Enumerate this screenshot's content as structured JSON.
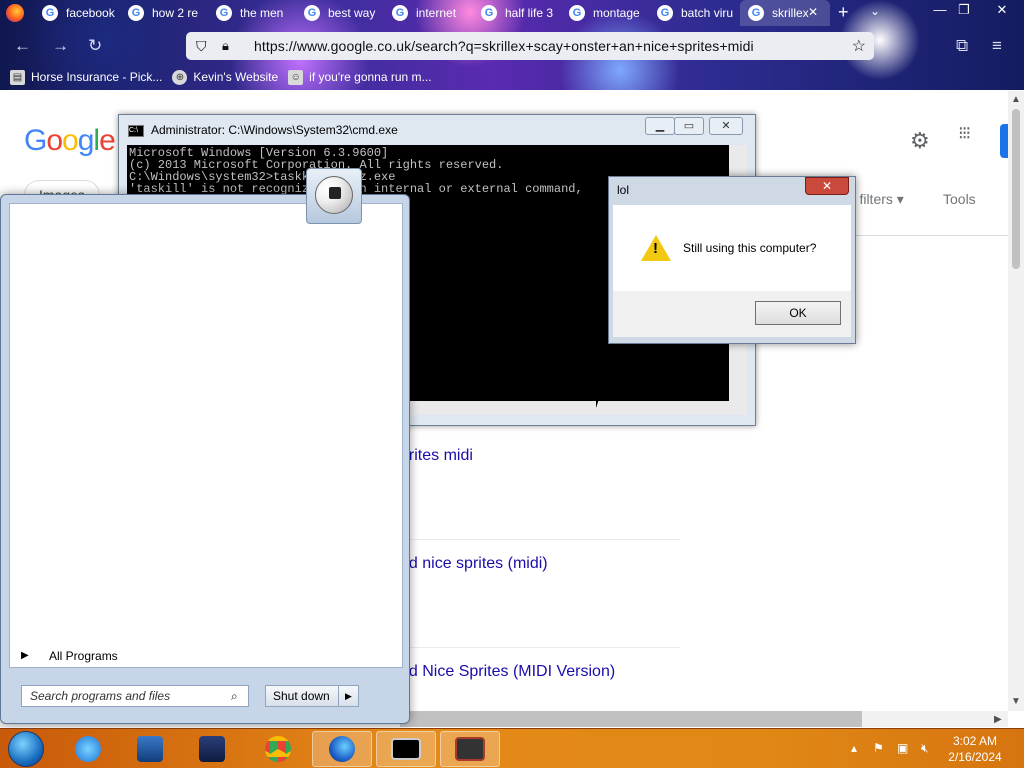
{
  "browser": {
    "tabs": [
      {
        "label": "facebook",
        "active": false
      },
      {
        "label": "how 2 re",
        "active": false
      },
      {
        "label": "the men",
        "active": false
      },
      {
        "label": "best way",
        "active": false
      },
      {
        "label": "internet",
        "active": false
      },
      {
        "label": "half life 3",
        "active": false
      },
      {
        "label": "montage",
        "active": false
      },
      {
        "label": "batch viru",
        "active": false
      },
      {
        "label": "skrillex",
        "active": true
      }
    ],
    "url": "https://www.google.co.uk/search?q=skrillex+scay+onster+an+nice+sprites+midi",
    "bookmarks": [
      {
        "label": "Horse Insurance - Pick...",
        "icon": "bookmark-page-icon"
      },
      {
        "label": "Kevin's Website",
        "icon": "globe-icon"
      },
      {
        "label": "if you're gonna run m...",
        "icon": "bookmark-page-icon"
      }
    ]
  },
  "google": {
    "logo": "Google",
    "query": "skrillex scay onster an nice sprites midi",
    "chip": "Images",
    "all_filters": "All filters",
    "tools": "Tools",
    "results": [
      "prites midi",
      "nd nice sprites (midi)",
      "nd Nice Sprites (MIDI Version)"
    ]
  },
  "cmd": {
    "title": "Administrator: C:\\Windows\\System32\\cmd.exe",
    "lines": [
      "Microsoft Windows [Version 6.3.9600]",
      "(c) 2013 Microsoft Corporation. All rights reserved.",
      "",
      "C:\\Windows\\system32>taskkill memz.exe",
      "'taskill' is not recognized as an internal or external command,"
    ]
  },
  "dialog": {
    "title": "lol",
    "message": "Still using this computer?",
    "ok": "OK",
    "icon": "warning-icon"
  },
  "start_menu": {
    "all_programs": "All Programs",
    "search_placeholder": "Search programs and files",
    "shutdown": "Shut down"
  },
  "taskbar": {
    "time": "3:02 AM",
    "date": "2/16/2024",
    "apps": [
      "internet-explorer-icon",
      "explorer-icon",
      "media-player-icon",
      "chrome-icon",
      "firefox-icon",
      "cmd-icon",
      "app-icon"
    ]
  }
}
